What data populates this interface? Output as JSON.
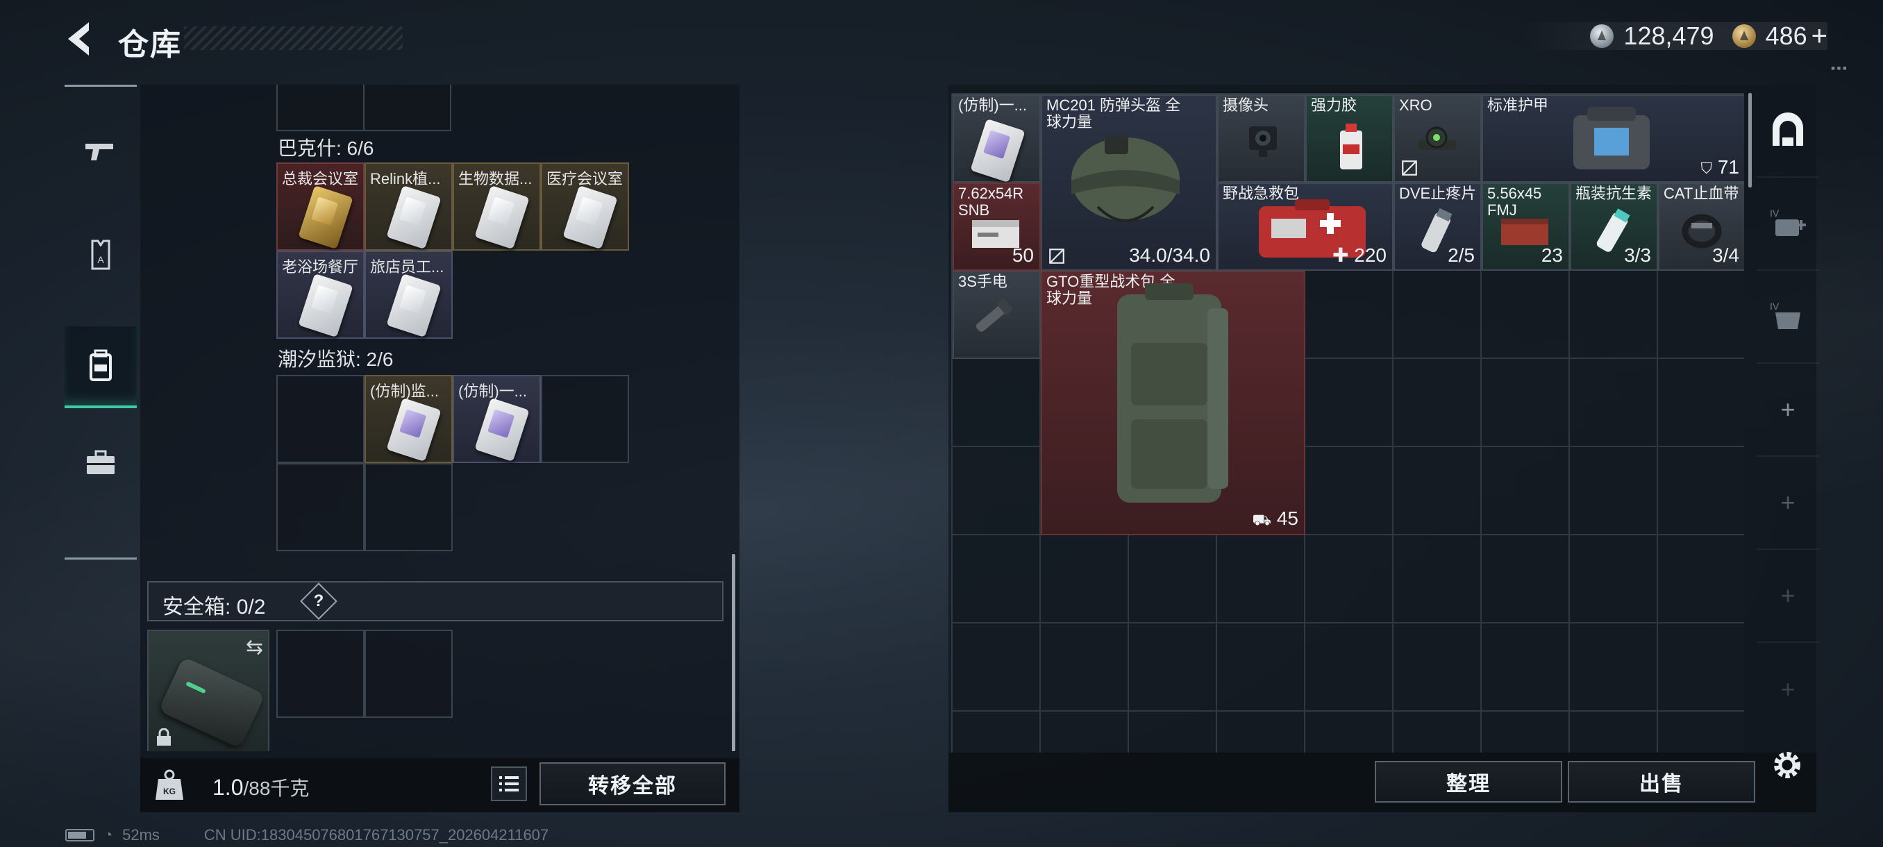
{
  "header": {
    "title": "仓库",
    "currency_silver": "128,479",
    "currency_gold": "486",
    "add_symbol": "+",
    "menu_dots": "▪▪▪"
  },
  "left_nav": {
    "items": [
      {
        "name": "weapons",
        "icon": "gun-icon"
      },
      {
        "name": "armor",
        "icon": "vest-icon"
      },
      {
        "name": "backpack",
        "icon": "backpack-icon",
        "active": true
      },
      {
        "name": "toolbox",
        "icon": "briefcase-icon"
      }
    ]
  },
  "stash": {
    "sections": [
      {
        "title": "巴克什: 6/6",
        "slots": [
          {
            "label": "总裁会议室",
            "style": "red",
            "card": "gold"
          },
          {
            "label": "Relink植...",
            "style": "item",
            "card": "white"
          },
          {
            "label": "生物数据...",
            "style": "item",
            "card": "white"
          },
          {
            "label": "医疗会议室",
            "style": "item",
            "card": "white"
          },
          {
            "label": "老浴场餐厅",
            "style": "blue",
            "card": "white"
          },
          {
            "label": "旅店员工...",
            "style": "blue",
            "card": "white"
          }
        ]
      },
      {
        "title": "潮汐监狱: 2/6",
        "slots": [
          {
            "label": "(仿制)监...",
            "style": "item",
            "card": "purple"
          },
          {
            "label": "(仿制)一...",
            "style": "blue",
            "card": "purple"
          }
        ]
      }
    ],
    "safe_box": {
      "label": "安全箱:",
      "count": "0/2",
      "help": "?",
      "swap_symbol": "⇆"
    },
    "weight": {
      "current": "1.0",
      "max": "/88千克"
    },
    "transfer_all_label": "转移全部"
  },
  "inventory": {
    "items": [
      {
        "label": "(仿制)一...",
        "count": ""
      },
      {
        "label": "MC201 防弹头盔 全球力量",
        "count": "34.0/34.0"
      },
      {
        "label": "摄像头",
        "count": ""
      },
      {
        "label": "强力胶",
        "count": ""
      },
      {
        "label": "XRO",
        "count": ""
      },
      {
        "label": "标准护甲",
        "count": "71"
      },
      {
        "label": "7.62x54R SNB",
        "count": "50"
      },
      {
        "label": "野战急救包",
        "count": "220"
      },
      {
        "label": "DVE止疼片",
        "count": "2/5"
      },
      {
        "label": "5.56x45 FMJ",
        "count": "23"
      },
      {
        "label": "瓶装抗生素",
        "count": "3/3"
      },
      {
        "label": "CAT止血带",
        "count": "3/4"
      },
      {
        "label": "3S手电",
        "count": ""
      },
      {
        "label": "GTO重型战术包 全球力量",
        "count": "45"
      }
    ],
    "sort_label": "整理",
    "sell_label": "出售"
  },
  "right_nav": {
    "items": [
      "home-base-icon",
      "iv-medkit-icon",
      "iv-armor-icon",
      "+",
      "+",
      "+",
      "+"
    ],
    "iv_label": "IV"
  },
  "footer": {
    "ping": "52ms",
    "uid": "CN UID:183045076801767130757_202604211607"
  },
  "colors": {
    "accent": "#3ec9a7",
    "rare_red": "#5a2a2e",
    "gold_item": "#3d372a"
  }
}
